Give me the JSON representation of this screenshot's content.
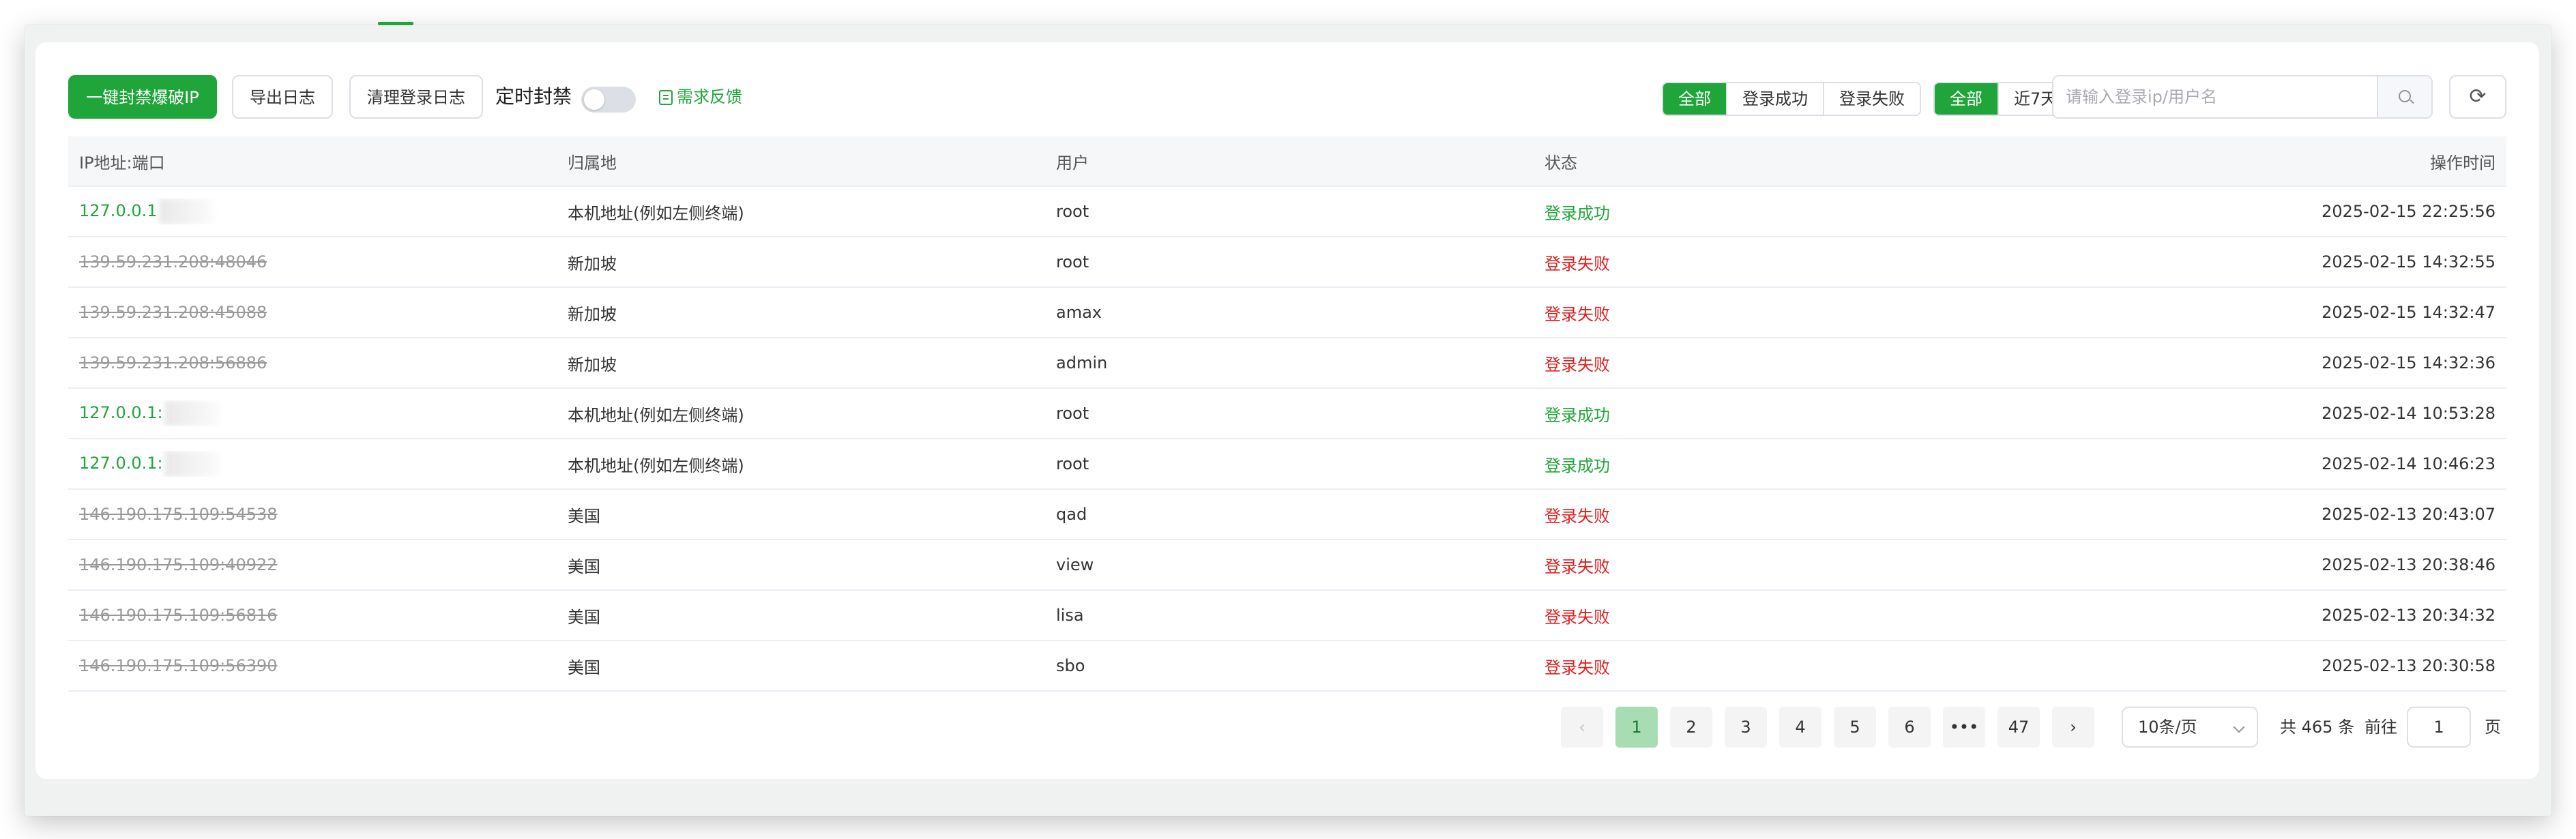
{
  "toolbar": {
    "ban_button": "一键封禁爆破IP",
    "export_button": "导出日志",
    "clear_button": "清理登录日志",
    "schedule_label": "定时封禁",
    "feedback_link": "需求反馈",
    "status_filter": [
      "全部",
      "登录成功",
      "登录失败"
    ],
    "status_filter_active": "全部",
    "time_filter": [
      "全部",
      "近7天"
    ],
    "time_filter_active": "全部",
    "search_placeholder": "请输入登录ip/用户名"
  },
  "table": {
    "headers": [
      "IP地址:端口",
      "归属地",
      "用户",
      "状态",
      "操作时间"
    ],
    "rows": [
      {
        "ip": "127.0.0.1",
        "ip_state": "ok",
        "location": "本机地址(例如左侧终端)",
        "user": "root",
        "status": "登录成功",
        "time": "2025-02-15 22:25:56"
      },
      {
        "ip": "139.59.231.208:48046",
        "ip_state": "bad",
        "location": "新加坡",
        "user": "root",
        "status": "登录失败",
        "time": "2025-02-15 14:32:55"
      },
      {
        "ip": "139.59.231.208:45088",
        "ip_state": "bad",
        "location": "新加坡",
        "user": "amax",
        "status": "登录失败",
        "time": "2025-02-15 14:32:47"
      },
      {
        "ip": "139.59.231.208:56886",
        "ip_state": "bad",
        "location": "新加坡",
        "user": "admin",
        "status": "登录失败",
        "time": "2025-02-15 14:32:36"
      },
      {
        "ip": "127.0.0.1:",
        "ip_state": "ok",
        "location": "本机地址(例如左侧终端)",
        "user": "root",
        "status": "登录成功",
        "time": "2025-02-14 10:53:28"
      },
      {
        "ip": "127.0.0.1:",
        "ip_state": "ok",
        "location": "本机地址(例如左侧终端)",
        "user": "root",
        "status": "登录成功",
        "time": "2025-02-14 10:46:23"
      },
      {
        "ip": "146.190.175.109:54538",
        "ip_state": "bad",
        "location": "美国",
        "user": "qad",
        "status": "登录失败",
        "time": "2025-02-13 20:43:07"
      },
      {
        "ip": "146.190.175.109:40922",
        "ip_state": "bad",
        "location": "美国",
        "user": "view",
        "status": "登录失败",
        "time": "2025-02-13 20:38:46"
      },
      {
        "ip": "146.190.175.109:56816",
        "ip_state": "bad",
        "location": "美国",
        "user": "lisa",
        "status": "登录失败",
        "time": "2025-02-13 20:34:32"
      },
      {
        "ip": "146.190.175.109:56390",
        "ip_state": "bad",
        "location": "美国",
        "user": "sbo",
        "status": "登录失败",
        "time": "2025-02-13 20:30:58"
      }
    ]
  },
  "pagination": {
    "pages": [
      "1",
      "2",
      "3",
      "4",
      "5",
      "6",
      "•••",
      "47"
    ],
    "current": "1",
    "page_size": "10条/页",
    "total": "共 465 条",
    "goto_label": "前往",
    "goto_value": "1",
    "page_suffix": "页"
  },
  "colors": {
    "accent": "#20a53a",
    "success": "#20a53a",
    "failure": "#e02020"
  }
}
